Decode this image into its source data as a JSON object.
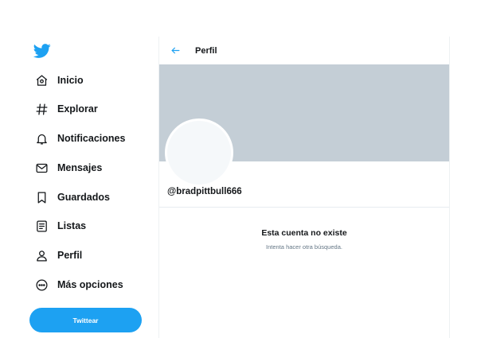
{
  "brand": {
    "icon": "twitter-bird-icon",
    "color": "#1da1f2"
  },
  "sidebar": {
    "items": [
      {
        "label": "Inicio",
        "icon": "home-icon"
      },
      {
        "label": "Explorar",
        "icon": "hashtag-icon"
      },
      {
        "label": "Notificaciones",
        "icon": "bell-icon"
      },
      {
        "label": "Mensajes",
        "icon": "envelope-icon"
      },
      {
        "label": "Guardados",
        "icon": "bookmark-icon"
      },
      {
        "label": "Listas",
        "icon": "list-icon"
      },
      {
        "label": "Perfil",
        "icon": "user-icon"
      },
      {
        "label": "Más opciones",
        "icon": "more-icon"
      }
    ],
    "tweet_button": "Twittear"
  },
  "header": {
    "title": "Perfil",
    "back_icon": "back-arrow-icon"
  },
  "profile": {
    "handle": "@bradpittbull666",
    "banner_color": "#c4ced6"
  },
  "empty_state": {
    "title": "Esta cuenta no existe",
    "subtitle": "Intenta hacer otra búsqueda."
  }
}
